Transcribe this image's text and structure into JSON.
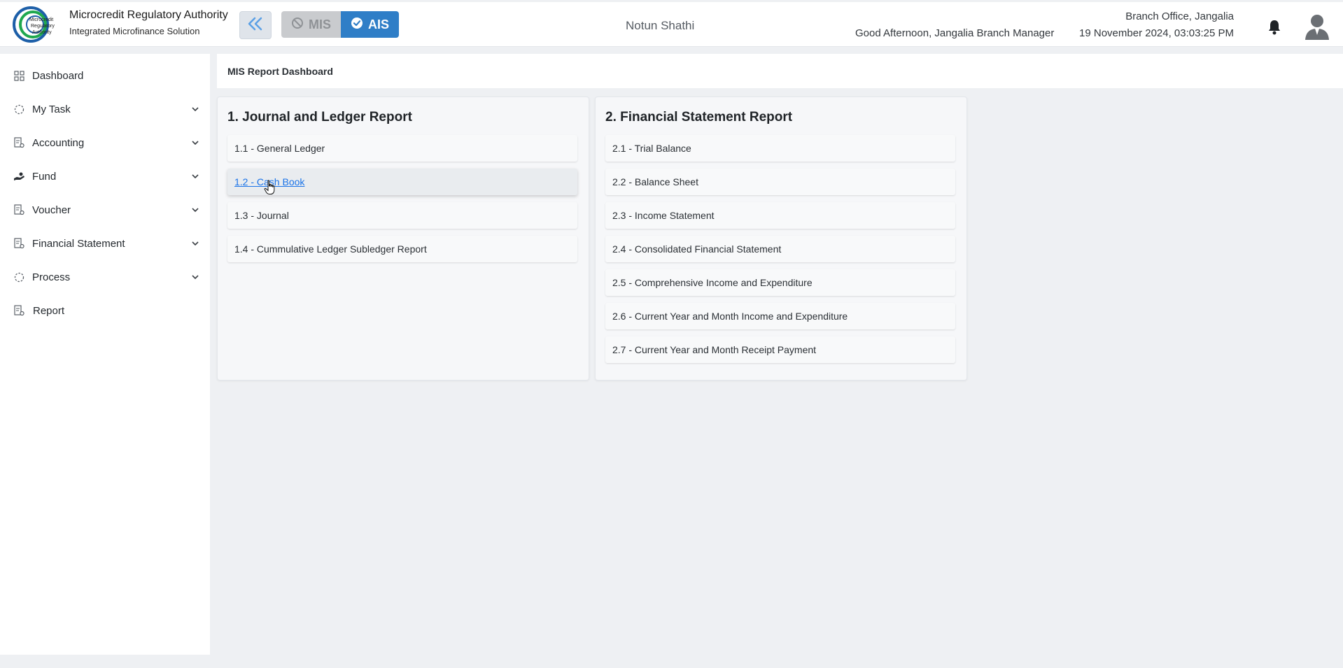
{
  "header": {
    "org_name": "Microcredit Regulatory Authority",
    "org_subtitle": "Integrated Microfinance Solution",
    "logo_text": "Microcredit Regulatory Authority",
    "mode_mis_label": "MIS",
    "mode_ais_label": "AIS",
    "active_mode": "AIS",
    "center_title": "Notun Shathi",
    "greeting": "Good Afternoon, Jangalia Branch Manager",
    "branch": "Branch Office, Jangalia",
    "datetime": "19 November 2024, 03:03:25 PM"
  },
  "sidebar": {
    "items": [
      {
        "label": "Dashboard",
        "icon": "grid-icon",
        "expandable": false
      },
      {
        "label": "My Task",
        "icon": "dashed-circle-icon",
        "expandable": true
      },
      {
        "label": "Accounting",
        "icon": "document-gear-icon",
        "expandable": true
      },
      {
        "label": "Fund",
        "icon": "hand-coin-icon",
        "expandable": true
      },
      {
        "label": "Voucher",
        "icon": "document-gear-icon",
        "expandable": true
      },
      {
        "label": "Financial Statement",
        "icon": "document-gear-icon",
        "expandable": true
      },
      {
        "label": "Process",
        "icon": "dashed-circle-icon",
        "expandable": true
      },
      {
        "label": "Report",
        "icon": "document-gear-icon",
        "expandable": false
      }
    ]
  },
  "main": {
    "page_title": "MIS Report Dashboard",
    "cards": [
      {
        "title": "1. Journal and Ledger Report",
        "items": [
          "1.1 - General Ledger",
          "1.2 - Cash Book",
          "1.3 - Journal",
          "1.4 - Cummulative Ledger Subledger Report"
        ]
      },
      {
        "title": "2. Financial Statement Report",
        "items": [
          "2.1 - Trial Balance",
          "2.2 - Balance Sheet",
          "2.3 - Income Statement",
          "2.4 - Consolidated Financial Statement",
          "2.5 - Comprehensive Income and Expenditure",
          "2.6 - Current Year and Month Income and Expenditure",
          "2.7 - Current Year and Month Receipt Payment"
        ]
      }
    ],
    "hovered_item": "1.2 - Cash Book"
  },
  "colors": {
    "accent": "#2f7ec7",
    "link_hover": "#1a73e8",
    "logo_green": "#1fa84f",
    "logo_blue": "#1d5fa8"
  }
}
